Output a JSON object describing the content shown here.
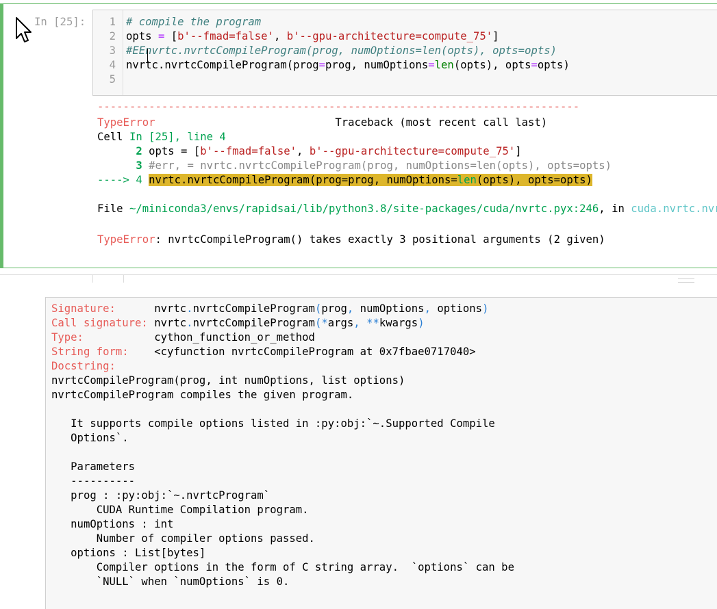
{
  "cell": {
    "prompt": "In [25]:",
    "line_numbers": [
      "1",
      "2",
      "3",
      "4",
      "5"
    ],
    "code": {
      "line1": "# compile the program",
      "line2_a": "opts ",
      "line2_eq": "=",
      "line2_b": " [",
      "line2_s1": "b'--fmad=false'",
      "line2_c": ", ",
      "line2_s2": "b'--gpu-architecture=compute_75'",
      "line2_d": "]",
      "line3": "#EEnvrtc.nvrtcCompileProgram(prog, numOptions=len(opts), opts=opts)",
      "line4_a": "nvrtc.nvrtcCompileProgram(prog",
      "line4_eq1": "=",
      "line4_b": "prog, numOptions",
      "line4_eq2": "=",
      "line4_len": "len",
      "line4_c": "(opts), opts",
      "line4_eq3": "=",
      "line4_d": "opts)"
    }
  },
  "traceback": {
    "dashes": "---------------------------------------------------------------------------",
    "error_type": "TypeError",
    "header_right": "                            Traceback (most recent call last)",
    "cell_line_a": "Cell ",
    "cell_line_b": "In [25], line 4",
    "l2_num": "      2 ",
    "l2_code_a": "opts = [",
    "l2_s1": "b'--fmad=false'",
    "l2_code_b": ", ",
    "l2_s2": "b'--gpu-architecture=compute_75'",
    "l2_code_c": "]",
    "l3_num": "      3 ",
    "l3_code": "#err, = nvrtc.nvrtcCompileProgram(prog, numOptions=len(opts), opts=opts)",
    "l4_arrow": "----> 4 ",
    "l4_code_a": "nvrtc.nvrtcCompileProgram(prog=prog, numOptions=",
    "l4_len": "len",
    "l4_code_b": "(opts), opts=opts)",
    "file_a": "File ",
    "file_path": "~/miniconda3/envs/rapidsai/lib/python3.8/site-packages/cuda/nvrtc.pyx:246",
    "file_b": ", in ",
    "file_fn": "cuda.nvrtc.nvrtcCompileProgram()",
    "final_type": "TypeError",
    "final_msg": ": nvrtcCompileProgram() takes exactly 3 positional arguments (2 given)"
  },
  "pager": {
    "signature_key": "Signature:      ",
    "signature_a": "nvrtc",
    "signature_dot": ".",
    "signature_b": "nvrtcCompileProgram",
    "signature_p1": "(",
    "signature_c": "prog",
    "signature_comma1": ",",
    "signature_d": " numOptions",
    "signature_comma2": ",",
    "signature_e": " options",
    "signature_p2": ")",
    "call_key": "Call signature: ",
    "call_a": "nvrtc",
    "call_dot": ".",
    "call_b": "nvrtcCompileProgram",
    "call_p1": "(",
    "call_star1": "*",
    "call_c": "args",
    "call_comma": ",",
    "call_star2": " **",
    "call_d": "kwargs",
    "call_p2": ")",
    "type_key": "Type:           ",
    "type_val": "cython_function_or_method",
    "string_key": "String form:    ",
    "string_val": "<cyfunction nvrtcCompileProgram at 0x7fbae0717040>",
    "doc_key": "Docstring:",
    "doc_lines": [
      "nvrtcCompileProgram(prog, int numOptions, list options)",
      "nvrtcCompileProgram compiles the given program.",
      "",
      "   It supports compile options listed in :py:obj:`~.Supported Compile",
      "   Options`.",
      "",
      "   Parameters",
      "   ----------",
      "   prog : :py:obj:`~.nvrtcProgram`",
      "       CUDA Runtime Compilation program.",
      "   numOptions : int",
      "       Number of compiler options passed.",
      "   options : List[bytes]",
      "       Compiler options in the form of C string array.  `options` can be",
      "       `NULL` when `numOptions` is 0."
    ]
  }
}
